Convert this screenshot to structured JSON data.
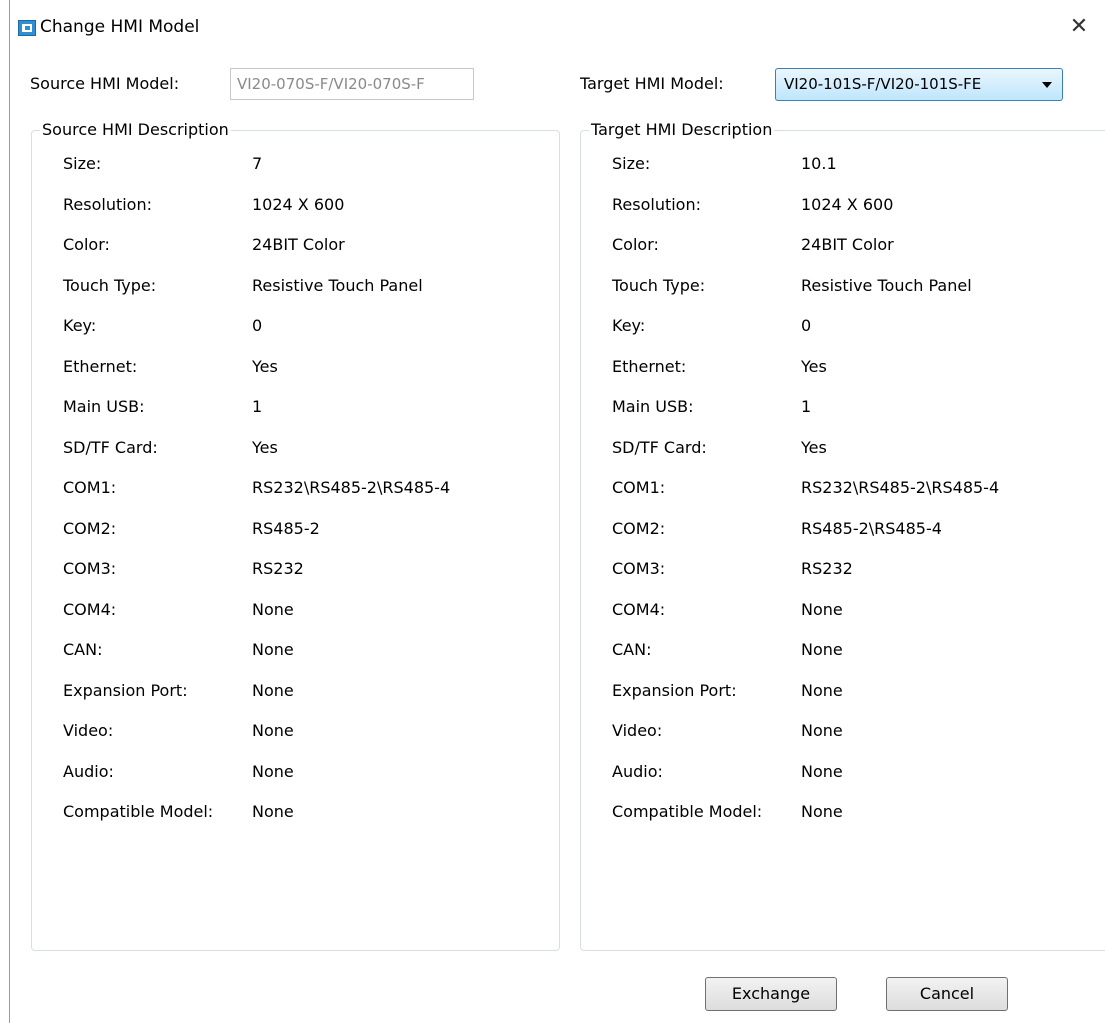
{
  "window": {
    "title": "Change HMI Model",
    "icon": "app-icon",
    "close_icon": "close-icon",
    "close_glyph": "✕"
  },
  "source": {
    "label": "Source HMI Model:",
    "value": "VI20-070S-F/VI20-070S-F",
    "group_title": "Source HMI Description",
    "rows": [
      {
        "key": "Size:",
        "value": "7"
      },
      {
        "key": "Resolution:",
        "value": "1024 X 600"
      },
      {
        "key": "Color:",
        "value": "24BIT Color"
      },
      {
        "key": "Touch Type:",
        "value": "Resistive Touch Panel"
      },
      {
        "key": "Key:",
        "value": "0"
      },
      {
        "key": "Ethernet:",
        "value": "Yes"
      },
      {
        "key": "Main USB:",
        "value": "1"
      },
      {
        "key": "SD/TF Card:",
        "value": "Yes"
      },
      {
        "key": "COM1:",
        "value": "RS232\\RS485-2\\RS485-4"
      },
      {
        "key": "COM2:",
        "value": "RS485-2"
      },
      {
        "key": "COM3:",
        "value": "RS232"
      },
      {
        "key": "COM4:",
        "value": "None"
      },
      {
        "key": "CAN:",
        "value": "None"
      },
      {
        "key": "Expansion Port:",
        "value": "None"
      },
      {
        "key": "Video:",
        "value": "None"
      },
      {
        "key": "Audio:",
        "value": "None"
      },
      {
        "key": "Compatible Model:",
        "value": "None"
      }
    ]
  },
  "target": {
    "label": "Target HMI Model:",
    "selected": "VI20-101S-F/VI20-101S-FE",
    "group_title": "Target HMI Description",
    "rows": [
      {
        "key": "Size:",
        "value": "10.1"
      },
      {
        "key": "Resolution:",
        "value": "1024 X 600"
      },
      {
        "key": "Color:",
        "value": "24BIT Color"
      },
      {
        "key": "Touch Type:",
        "value": "Resistive Touch Panel"
      },
      {
        "key": "Key:",
        "value": "0"
      },
      {
        "key": "Ethernet:",
        "value": "Yes"
      },
      {
        "key": "Main USB:",
        "value": "1"
      },
      {
        "key": "SD/TF Card:",
        "value": "Yes"
      },
      {
        "key": "COM1:",
        "value": "RS232\\RS485-2\\RS485-4"
      },
      {
        "key": "COM2:",
        "value": "RS485-2\\RS485-4"
      },
      {
        "key": "COM3:",
        "value": "RS232"
      },
      {
        "key": "COM4:",
        "value": "None"
      },
      {
        "key": "CAN:",
        "value": "None"
      },
      {
        "key": "Expansion Port:",
        "value": "None"
      },
      {
        "key": "Video:",
        "value": "None"
      },
      {
        "key": "Audio:",
        "value": "None"
      },
      {
        "key": "Compatible Model:",
        "value": "None"
      }
    ]
  },
  "buttons": {
    "exchange": "Exchange",
    "cancel": "Cancel"
  },
  "colors": {
    "select_border": "#3c7fb1",
    "select_fill": "#bee6fd",
    "group_border": "#d5dfe5"
  }
}
